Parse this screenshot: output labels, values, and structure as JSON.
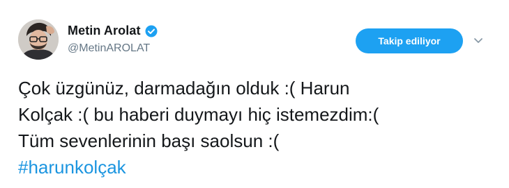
{
  "author": {
    "display_name": "Metin Arolat",
    "handle": "@MetinAROLAT",
    "verified": true
  },
  "follow_button": {
    "label": "Takip ediliyor"
  },
  "menu": {
    "icon": "chevron-down-icon"
  },
  "tweet": {
    "lines": [
      "Çok üzgünüz, darmadağın olduk :( Harun",
      "Kolçak :( bu haberi duymayı hiç istemezdim:(",
      "Tüm sevenlerinin başı saolsun :("
    ],
    "hashtag": "#harunkolçak"
  },
  "colors": {
    "accent": "#1da1f2",
    "hashtag": "#1b95e0",
    "handle_gray": "#657786",
    "text": "#14171a"
  }
}
